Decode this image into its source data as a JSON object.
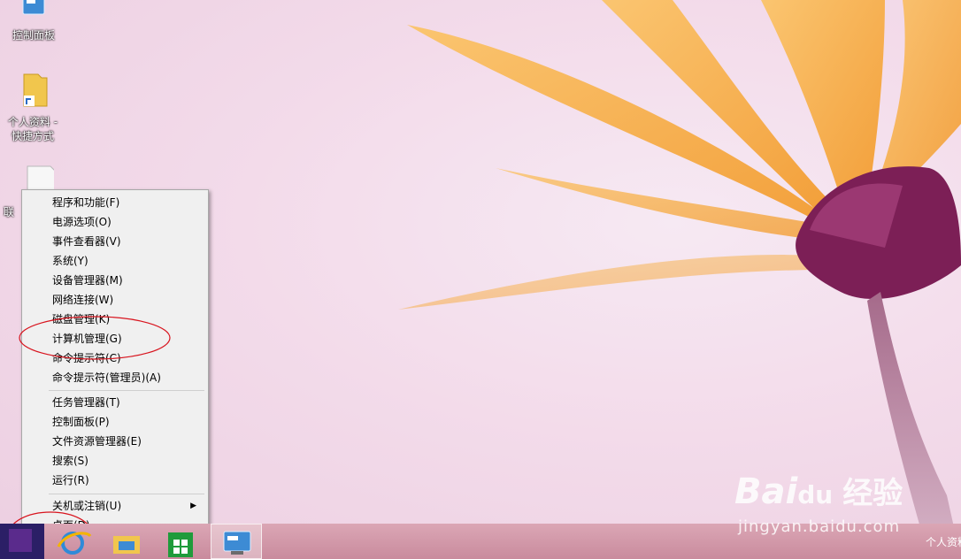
{
  "desktop": {
    "icons": [
      {
        "label": "控制面板",
        "icon": "control-panel-icon"
      },
      {
        "label": "个人资料 -\n快捷方式",
        "icon": "folder-shortcut-icon"
      },
      {
        "label": "联",
        "icon": "text-file-shortcut-icon"
      }
    ]
  },
  "context_menu": {
    "groups": [
      [
        "程序和功能(F)",
        "电源选项(O)",
        "事件查看器(V)",
        "系统(Y)",
        "设备管理器(M)",
        "网络连接(W)",
        "磁盘管理(K)",
        "计算机管理(G)",
        "命令提示符(C)",
        "命令提示符(管理员)(A)"
      ],
      [
        "任务管理器(T)",
        "控制面板(P)",
        "文件资源管理器(E)",
        "搜索(S)",
        "运行(R)"
      ],
      [
        "关机或注销(U)",
        "桌面(D)"
      ]
    ],
    "submenu_item": "关机或注销(U)"
  },
  "taskbar": {
    "buttons": [
      "start-button",
      "internet-explorer-button",
      "file-explorer-button",
      "store-button",
      "control-panel-button"
    ],
    "tray_text": "个人资料"
  },
  "watermark": {
    "brand": "Bai",
    "brand_suffix": "du",
    "brand_cn": "经验",
    "url": "jingyan.baidu.com"
  },
  "colors": {
    "annotation": "#d8141e",
    "taskbar": "#cf94a6",
    "petal": "#f4a63c"
  }
}
